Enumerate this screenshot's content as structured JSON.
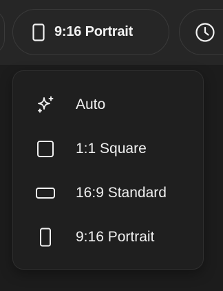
{
  "toolbar": {
    "aspect_button": {
      "label": "9:16 Portrait",
      "icon": "portrait-rect-icon"
    },
    "time_button": {
      "icon": "clock-icon"
    }
  },
  "aspect_menu": {
    "items": [
      {
        "label": "Auto",
        "icon": "sparkles-icon"
      },
      {
        "label": "1:1 Square",
        "icon": "square-icon"
      },
      {
        "label": "16:9 Standard",
        "icon": "landscape-rect-icon"
      },
      {
        "label": "9:16 Portrait",
        "icon": "portrait-rect-icon"
      }
    ]
  },
  "colors": {
    "background": "#1c1c1c",
    "toolbar": "#262626",
    "menu": "#1f1f1f",
    "text": "#f0f0f0",
    "border": "#3a3a3a"
  }
}
